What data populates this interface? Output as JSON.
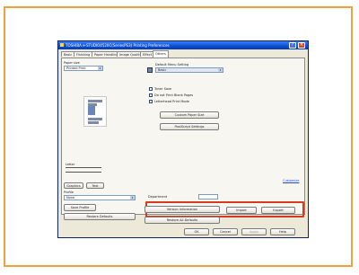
{
  "dialog": {
    "title": "TOSHIBA e-STUDIO4520C(SeriesPS3) Printing Preferences",
    "tabs": [
      "Basic",
      "Finishing",
      "Paper Handling",
      "Image Quality",
      "Effect",
      "Others"
    ],
    "active_tab": "Others"
  },
  "left_panel": {
    "paper_size_label": "Paper size",
    "paper_size_value": "Printed Print",
    "status_text": "Letter",
    "tabs": [
      "Graphics",
      "Text"
    ],
    "profile_label": "Profile",
    "profile_value": "None",
    "save_profile_label": "Save Profile",
    "restore_defaults_label": "Restore Defaults"
  },
  "right_panel": {
    "default_menu_label": "Default Menu Setting",
    "default_menu_value": "Basic",
    "checkboxes": [
      "Toner Save",
      "Do not Print Blank Pages",
      "Letterhead Print Mode"
    ],
    "custom_paper_size_label": "Custom Paper Size",
    "postscript_settings_label": "PostScript Settings",
    "customize_link": "Customize",
    "department_label": "Department",
    "custom_settings_label": "Custom Settings File",
    "import_label": "Import",
    "export_label": "Export",
    "version_info_label": "Version Information",
    "restore_all_defaults_label": "Restore All Defaults"
  },
  "footer": {
    "ok": "OK",
    "cancel": "Cancel",
    "apply": "Apply",
    "help": "Help"
  },
  "colors": {
    "frame_border": "#f0a03c",
    "highlight": "#d9391e",
    "titlebar": "#0a4fd0"
  }
}
